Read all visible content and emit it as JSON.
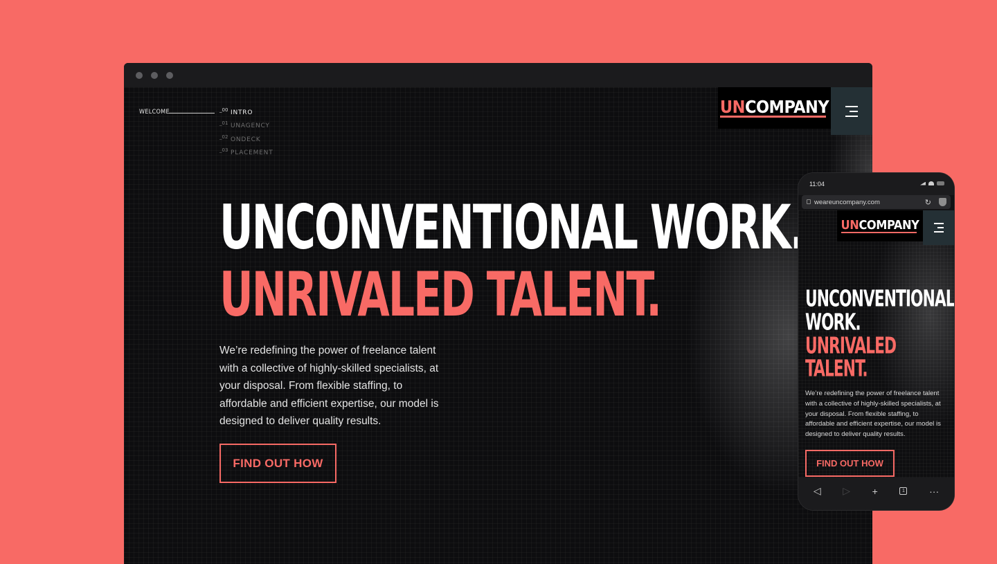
{
  "brand": {
    "un": "UN",
    "company": "COMPANY"
  },
  "desktop": {
    "welcome": "WELCOME",
    "nav": [
      {
        "num": "_00",
        "label": "INTRO",
        "active": true
      },
      {
        "num": "_01",
        "label": "UNAGENCY",
        "active": false
      },
      {
        "num": "_02",
        "label": "ONDECK",
        "active": false
      },
      {
        "num": "_03",
        "label": "PLACEMENT",
        "active": false
      }
    ],
    "headline_1": "UNCONVENTIONAL WORK.",
    "headline_2": "UNRIVALED TALENT.",
    "lead": "We’re redefining the power of freelance talent with a collective of highly-skilled specialists, at your disposal. From flexible staffing, to affordable and efficient expertise, our model is designed to deliver quality results.",
    "cta": "FIND OUT HOW"
  },
  "phone": {
    "time": "11:04",
    "url": "weareuncompany.com",
    "headline": [
      "UNCONVENTIONAL",
      "WORK.",
      "UNRIVALED",
      "TALENT."
    ],
    "lead": "We’re redefining the power of freelance talent with a collective of highly-skilled specialists, at your disposal. From flexible staffing, to affordable and efficient expertise, our model is designed to deliver quality results.",
    "cta": "FIND OUT HOW",
    "tabs_count": "1",
    "toolbar_icons": [
      "back-icon",
      "forward-icon",
      "new-tab-icon",
      "tabs-icon",
      "more-icon"
    ]
  },
  "colors": {
    "background": "#f86a65",
    "accent": "#f86a65",
    "page": "#0d0d0f",
    "menu": "#243035"
  }
}
